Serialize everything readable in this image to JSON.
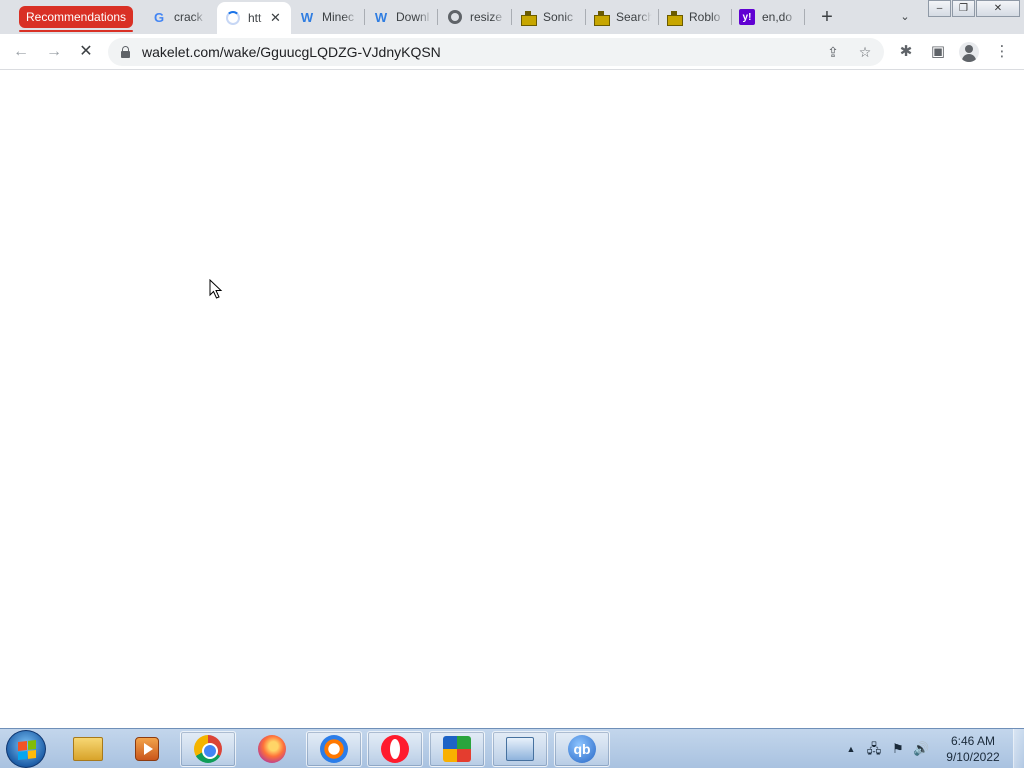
{
  "browser": {
    "tab_group_label": "Recommendations",
    "tabs": [
      {
        "title": "crack",
        "icon": "google-icon"
      },
      {
        "title": "htt",
        "icon": "loading-spinner-icon",
        "active": true
      },
      {
        "title": "Minec",
        "icon": "wikipedia-icon"
      },
      {
        "title": "Downl",
        "icon": "wikipedia-icon"
      },
      {
        "title": "resize",
        "icon": "globe-icon"
      },
      {
        "title": "Sonic",
        "icon": "castle-icon"
      },
      {
        "title": "Search",
        "icon": "castle-icon"
      },
      {
        "title": "Roblo",
        "icon": "castle-icon"
      },
      {
        "title": "en,do",
        "icon": "yahoo-icon"
      }
    ],
    "glyphs": {
      "close": "✕",
      "new_tab": "+",
      "tab_search": "⌄",
      "back": "←",
      "forward": "→",
      "stop": "✕",
      "share": "⇪",
      "star": "☆",
      "extensions": "✱",
      "side_panel": "▣",
      "menu": "⋮",
      "minimize": "–",
      "restore": "❐",
      "window_close": "✕",
      "google": "G",
      "wikipedia": "W",
      "yahoo": "y!"
    },
    "url": "wakelet.com/wake/GguucgLQDZG-VJdnyKQSN"
  },
  "taskbar": {
    "apps": [
      "windows-explorer",
      "media-player",
      "google-chrome",
      "firefox",
      "avast-secure-browser",
      "opera",
      "avg",
      "control-panel",
      "qbittorrent"
    ],
    "qbittorrent_label": "qb",
    "tray_glyphs": {
      "show_hidden": "▲",
      "network": "🖧",
      "action_center": "⚑",
      "volume": "🔊"
    },
    "time": "6:46 AM",
    "date": "9/10/2022"
  },
  "colors": {
    "tab_group": "#d93025",
    "tab_strip": "#dee1e6",
    "omnibox": "#f1f3f4",
    "taskbar": "#b5cbe6"
  }
}
